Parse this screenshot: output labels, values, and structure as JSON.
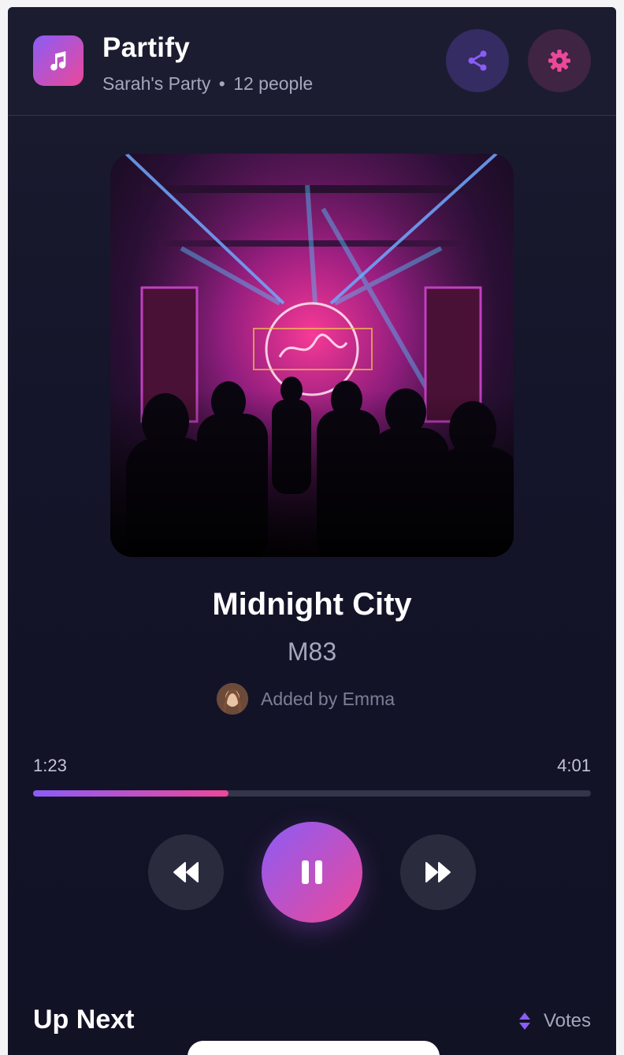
{
  "header": {
    "app_name": "Partify",
    "party_name": "Sarah's Party",
    "separator": "•",
    "people_count": "12 people",
    "logo_icon": "music-note-icon",
    "share_icon": "share-icon",
    "settings_icon": "gear-icon"
  },
  "now_playing": {
    "cover_icon": "album-cover-image",
    "title": "Midnight City",
    "artist": "M83",
    "added_by": "Added by Emma",
    "current_time": "1:23",
    "total_time": "4:01",
    "progress": 0.35
  },
  "controls": {
    "prev_icon": "rewind-icon",
    "play_icon": "pause-icon",
    "next_icon": "fast-forward-icon"
  },
  "up_next": {
    "title": "Up Next",
    "sort_label": "Votes",
    "sort_icon": "sort-icon"
  },
  "colors": {
    "accent_start": "#8b5cf6",
    "accent_end": "#ec4899",
    "background": "#14142a"
  }
}
